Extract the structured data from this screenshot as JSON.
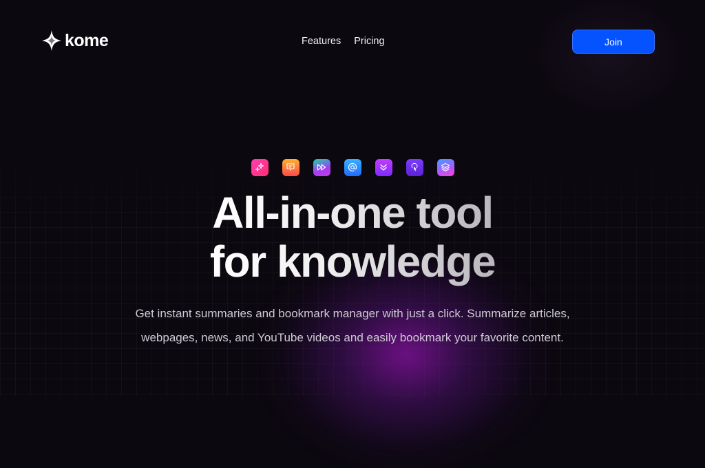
{
  "brand": {
    "name": "kome",
    "logo_icon": "four-point-star-icon"
  },
  "nav": {
    "links": [
      {
        "label": "Features"
      },
      {
        "label": "Pricing"
      }
    ],
    "join_label": "Join",
    "join_color": "#0453ff"
  },
  "feature_icons": [
    {
      "name": "sparkles-icon",
      "gradient": [
        "#ff2f9d",
        "#ff4fa0"
      ]
    },
    {
      "name": "chat-bubble-icon",
      "gradient": [
        "#ffb02e",
        "#ff4a4a"
      ]
    },
    {
      "name": "fast-forward-icon",
      "gradient": [
        "#19d6a6",
        "#a43df5"
      ]
    },
    {
      "name": "at-sign-icon",
      "gradient": [
        "#3bb0ff",
        "#1f6bff"
      ]
    },
    {
      "name": "double-chevron-down-icon",
      "gradient": [
        "#c33dff",
        "#7a2cff"
      ]
    },
    {
      "name": "tap-cursor-icon",
      "gradient": [
        "#7b3cff",
        "#5a22d8"
      ]
    },
    {
      "name": "layers-icon",
      "gradient": [
        "#3fa0ff",
        "#ff3fd0"
      ]
    }
  ],
  "hero": {
    "title_line1": "All-in-one tool",
    "title_line2": "for knowledge",
    "subtitle_line1": "Get instant summaries and bookmark manager with just a click. Summarize articles,",
    "subtitle_line2": "webpages, news, and YouTube videos and easily bookmark your favorite content."
  }
}
